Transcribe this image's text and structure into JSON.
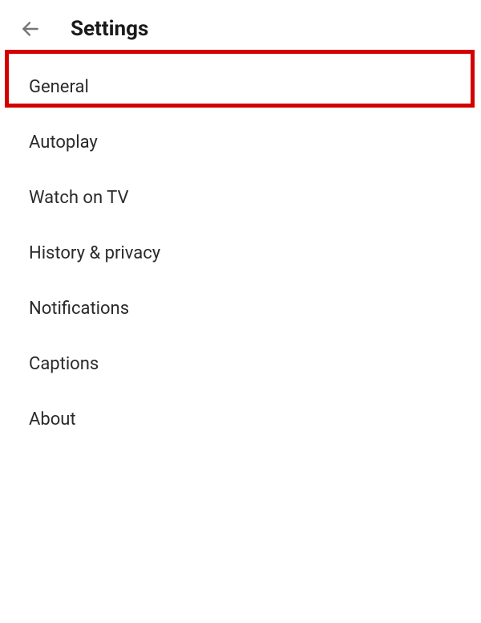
{
  "header": {
    "title": "Settings"
  },
  "items": [
    {
      "label": "General"
    },
    {
      "label": "Autoplay"
    },
    {
      "label": "Watch on TV"
    },
    {
      "label": "History & privacy"
    },
    {
      "label": "Notifications"
    },
    {
      "label": "Captions"
    },
    {
      "label": "About"
    }
  ],
  "highlight": {
    "color": "#d40000",
    "target_index": 0
  }
}
